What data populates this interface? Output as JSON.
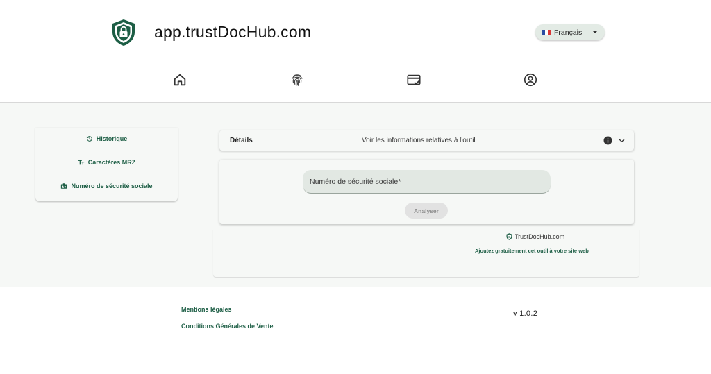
{
  "header": {
    "title": "app.trustDocHub.com",
    "logo_icon": "shield-lock-icon",
    "language": {
      "label": "Français",
      "flag_colors": [
        "#2b4ea3",
        "#ffffff",
        "#d93636"
      ]
    }
  },
  "nav": {
    "items": [
      {
        "icon": "home-icon"
      },
      {
        "icon": "fingerprint-icon"
      },
      {
        "icon": "card-check-icon"
      },
      {
        "icon": "account-circle-icon"
      }
    ]
  },
  "sidebar": {
    "items": [
      {
        "label": "Historique",
        "icon": "history-icon"
      },
      {
        "label": "Caractères MRZ",
        "icon": "text-size-icon"
      },
      {
        "label": "Numéro de sécurité sociale",
        "icon": "id-card-icon"
      }
    ]
  },
  "details": {
    "title": "Détails",
    "info_text": "Voir les informations relatives à l'outil"
  },
  "form": {
    "ssn_placeholder": "Numéro de sécurité sociale*",
    "ssn_value": "",
    "analyze_label": "Analyser"
  },
  "promo": {
    "brand": "TrustDocHub.com",
    "link": "Ajoutez gratuitement cet outil à votre site web"
  },
  "footer": {
    "links": [
      "Mentions légales",
      "Conditions Générales de Vente"
    ],
    "version": "v 1.0.2"
  },
  "colors": {
    "brand_green": "#1d5e45",
    "background": "#f6f8f6",
    "field_bg": "#e2e8e3"
  }
}
